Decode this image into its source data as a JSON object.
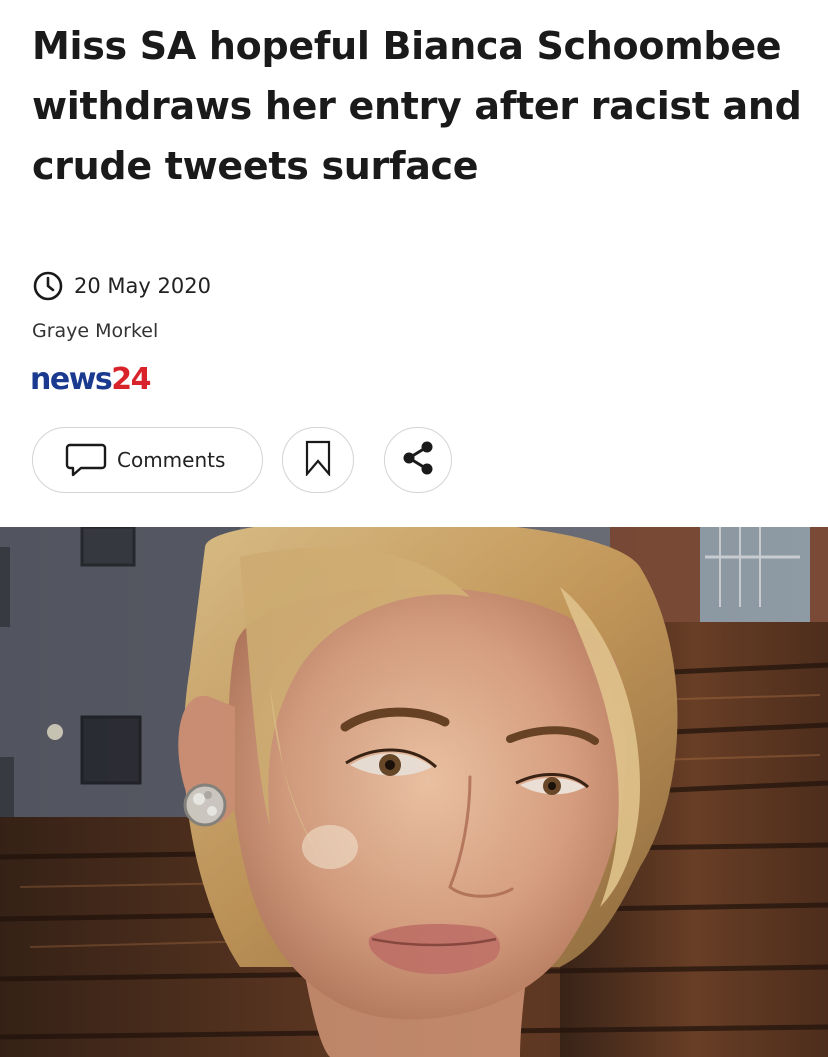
{
  "article": {
    "headline": "Miss SA hopeful Bianca Schoombee withdraws her entry after racist and crude tweets surface",
    "date": "20 May 2020",
    "author": "Graye Morkel",
    "publisher_logo": {
      "part1": "news",
      "part2": "24",
      "colors": {
        "news": "#1a3a8f",
        "24": "#d8232a"
      }
    }
  },
  "actions": {
    "comments_label": "Comments",
    "icons": {
      "date": "clock-icon",
      "comments": "comment-bubble-icon",
      "bookmark": "bookmark-icon",
      "share": "share-icon"
    }
  },
  "hero_image": {
    "subject": "selfie-photo",
    "description_visible": false
  }
}
